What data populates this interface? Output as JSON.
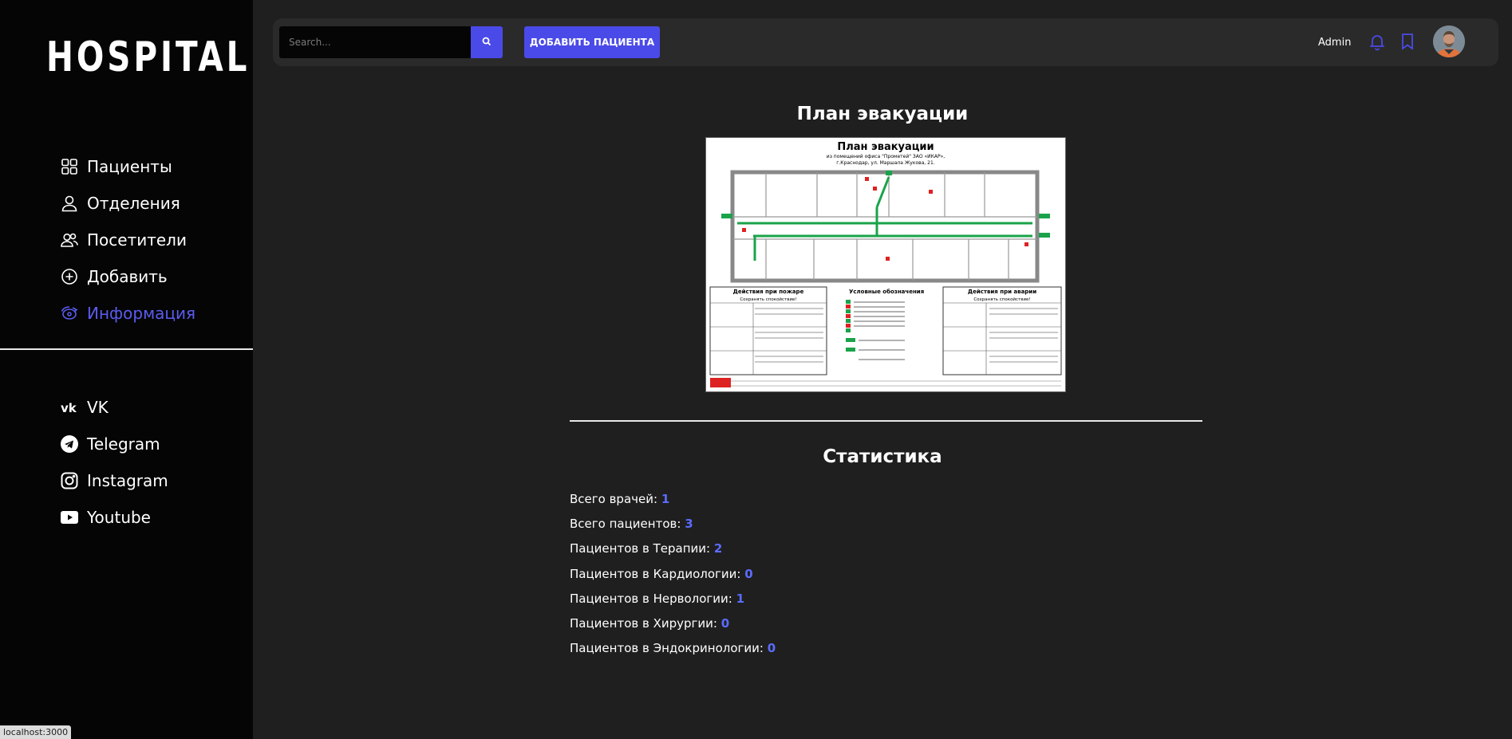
{
  "app": {
    "logo": "HOSPITAL"
  },
  "sidebar": {
    "items": [
      {
        "label": "Пациенты",
        "icon": "grid-icon"
      },
      {
        "label": "Отделения",
        "icon": "user-icon"
      },
      {
        "label": "Посетители",
        "icon": "users-icon"
      },
      {
        "label": "Добавить",
        "icon": "plus-circle-icon"
      },
      {
        "label": "Информация",
        "icon": "info-icon",
        "active": true
      }
    ],
    "social": [
      {
        "label": "VK",
        "icon": "vk-icon"
      },
      {
        "label": "Telegram",
        "icon": "telegram-icon"
      },
      {
        "label": "Instagram",
        "icon": "instagram-icon"
      },
      {
        "label": "Youtube",
        "icon": "youtube-icon"
      }
    ]
  },
  "header": {
    "search_placeholder": "Search...",
    "add_patient_label": "ДОБАВИТЬ ПАЦИЕНТА",
    "user_name": "Admin"
  },
  "main": {
    "plan_title": "План эвакуации",
    "plan_image": {
      "title": "План эвакуации",
      "subtitle1": "из помещений офиса \"Прометей\" ЗАО «ИКАР»,",
      "subtitle2": "г.Краснодар, ул. Маршала Жукова, 21.",
      "fire_actions": "Действия при пожаре",
      "legend": "Условные обозначения",
      "emergency_actions": "Действия при аварии",
      "calm": "Сохранять спокойствие!"
    },
    "stats_title": "Статистика",
    "stats": [
      {
        "label": "Всего врачей:",
        "value": "1"
      },
      {
        "label": "Всего пациентов:",
        "value": "3"
      },
      {
        "label": "Пациентов в Терапии:",
        "value": "2"
      },
      {
        "label": "Пациентов в Кардиологии:",
        "value": "0"
      },
      {
        "label": "Пациентов в Нервологии:",
        "value": "1"
      },
      {
        "label": "Пациентов в Хирургии:",
        "value": "0"
      },
      {
        "label": "Пациентов в Эндокринологии:",
        "value": "0"
      }
    ]
  },
  "status_bar": {
    "url": "localhost:3000"
  },
  "colors": {
    "accent": "#4a4ae8",
    "active_nav": "#5b5bf0",
    "stat_value": "#5b6cff"
  }
}
